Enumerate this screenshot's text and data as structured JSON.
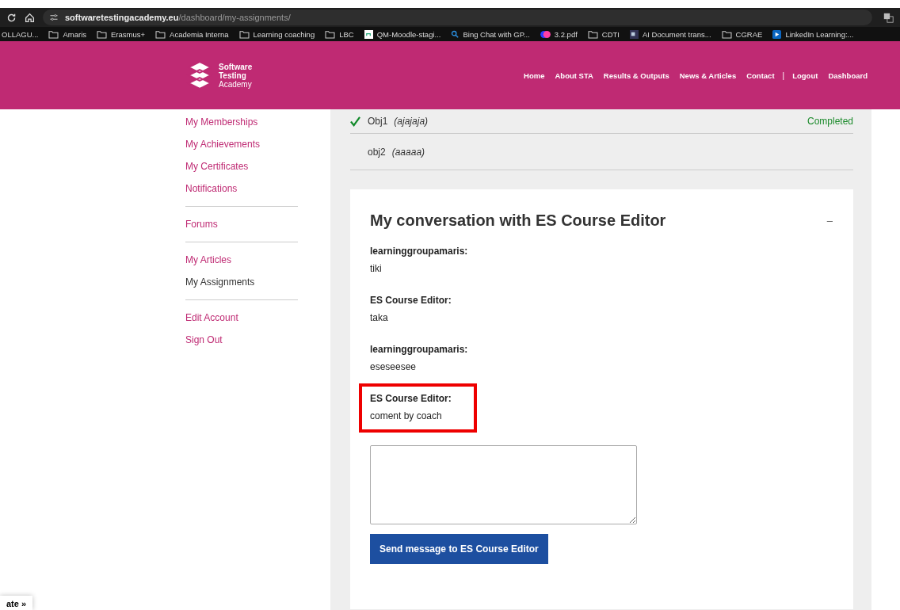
{
  "browser": {
    "url_host": "softwaretestingacademy.eu",
    "url_path": "/dashboard/my-assignments/",
    "bookmarks": [
      {
        "kind": "text",
        "label": "OLLAGU..."
      },
      {
        "kind": "folder",
        "label": "Amaris"
      },
      {
        "kind": "folder",
        "label": "Erasmus+"
      },
      {
        "kind": "folder",
        "label": "Academia Interna"
      },
      {
        "kind": "folder",
        "label": "Learning coaching"
      },
      {
        "kind": "folder",
        "label": "LBC"
      },
      {
        "kind": "site",
        "label": "QM-Moodle-stagi..."
      },
      {
        "kind": "search",
        "label": "Bing Chat with GP..."
      },
      {
        "kind": "pdf",
        "label": "3.2.pdf"
      },
      {
        "kind": "folder",
        "label": "CDTI"
      },
      {
        "kind": "doc",
        "label": "AI Document trans..."
      },
      {
        "kind": "folder",
        "label": "CGRAE"
      },
      {
        "kind": "video",
        "label": "LinkedIn Learning:..."
      }
    ]
  },
  "header": {
    "logo": [
      "Software",
      "Testing",
      "Academy"
    ],
    "nav": [
      {
        "kind": "link",
        "label": "Home"
      },
      {
        "kind": "link",
        "label": "About STA"
      },
      {
        "kind": "link",
        "label": "Results & Outputs"
      },
      {
        "kind": "link",
        "label": "News & Articles"
      },
      {
        "kind": "link",
        "label": "Contact"
      },
      {
        "kind": "separator",
        "label": "|"
      },
      {
        "kind": "link",
        "label": "Logout"
      },
      {
        "kind": "link",
        "label": "Dashboard"
      }
    ]
  },
  "sidebar": {
    "groups": [
      [
        {
          "label": "My Memberships",
          "selected": false
        },
        {
          "label": "My Achievements",
          "selected": false
        },
        {
          "label": "My Certificates",
          "selected": false
        },
        {
          "label": "Notifications",
          "selected": false
        }
      ],
      [
        {
          "label": "Forums",
          "selected": false
        }
      ],
      [
        {
          "label": "My Articles",
          "selected": false
        },
        {
          "label": "My Assignments",
          "selected": true
        }
      ],
      [
        {
          "label": "Edit Account",
          "selected": false
        },
        {
          "label": "Sign Out",
          "selected": false
        }
      ]
    ]
  },
  "objectives": [
    {
      "name": "Obj1",
      "detail": "(ajajaja)",
      "completed": true,
      "status": "Completed"
    },
    {
      "name": "obj2",
      "detail": "(aaaaa)",
      "completed": false
    }
  ],
  "conversation": {
    "title": "My conversation with ES Course Editor",
    "collapse": "–",
    "messages": [
      {
        "author": "learninggroupamaris:",
        "text": "tiki",
        "highlighted": false
      },
      {
        "author": "ES Course Editor:",
        "text": "taka",
        "highlighted": false
      },
      {
        "author": "learninggroupamaris:",
        "text": "eseseesee",
        "highlighted": false
      },
      {
        "author": "ES Course Editor:",
        "text": "coment by coach",
        "highlighted": true
      }
    ],
    "send_button": "Send message to ES Course Editor"
  },
  "floating_tab": "ate »"
}
